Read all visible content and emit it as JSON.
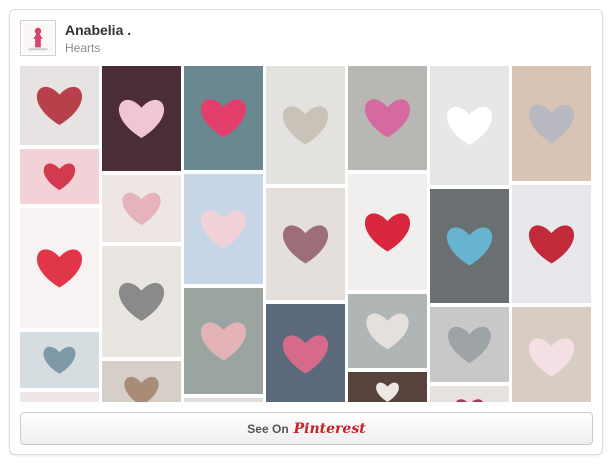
{
  "board": {
    "owner": "Anabelia .",
    "name": "Hearts"
  },
  "avatar_icon": "avatar-icon",
  "pins": [
    {
      "col": 0,
      "desc": "gingham fabric hearts",
      "colors": [
        "#e8e3e3",
        "#b8404a"
      ]
    },
    {
      "col": 0,
      "desc": "crochet heart red",
      "colors": [
        "#f2d2d6",
        "#d23a4f"
      ]
    },
    {
      "col": 0,
      "desc": "heart garland",
      "colors": [
        "#f8f2f2",
        "#e03648"
      ]
    },
    {
      "col": 0,
      "desc": "blue hearts in bowl",
      "colors": [
        "#d6dde0",
        "#7e9aa8"
      ]
    },
    {
      "col": 0,
      "desc": "pink hearts",
      "colors": [
        "#efe7e7",
        "#c8a0a6"
      ]
    },
    {
      "col": 1,
      "desc": "heart bouquet pot",
      "colors": [
        "#4b2d3a",
        "#f0c6d2"
      ]
    },
    {
      "col": 1,
      "desc": "pink felt heart",
      "colors": [
        "#ede6e4",
        "#e7b3bb"
      ]
    },
    {
      "col": 1,
      "desc": "grey fabric hearts",
      "colors": [
        "#e9e6e2",
        "#8a8a8a"
      ]
    },
    {
      "col": 1,
      "desc": "hanging hearts",
      "colors": [
        "#d6cfc8",
        "#a88c78"
      ]
    },
    {
      "col": 2,
      "desc": "pink crochet heart",
      "colors": [
        "#6a8890",
        "#e2406a"
      ]
    },
    {
      "col": 2,
      "desc": "birdhouse hearts",
      "colors": [
        "#c7d6e6",
        "#f0d2d8"
      ]
    },
    {
      "col": 2,
      "desc": "floral fabric heart",
      "colors": [
        "#9aa5a0",
        "#e3b3b8"
      ]
    },
    {
      "col": 2,
      "desc": "red heart",
      "colors": [
        "#e1dedc",
        "#c83a4a"
      ]
    },
    {
      "col": 3,
      "desc": "wicker heart with roses",
      "colors": [
        "#e3e2de",
        "#c8c2b8"
      ]
    },
    {
      "col": 3,
      "desc": "button hearts",
      "colors": [
        "#e5dfdc",
        "#9c6e7a"
      ]
    },
    {
      "col": 3,
      "desc": "knitted striped hearts",
      "colors": [
        "#5a6a7a",
        "#d66a8a"
      ]
    },
    {
      "col": 4,
      "desc": "butterfly heart",
      "colors": [
        "#b9b7b3",
        "#d46aa0"
      ]
    },
    {
      "col": 4,
      "desc": "crochet hearts basket",
      "colors": [
        "#f1eeee",
        "#d7263d"
      ]
    },
    {
      "col": 4,
      "desc": "lace hearts",
      "colors": [
        "#b0b5b6",
        "#e4e1dd"
      ]
    },
    {
      "col": 4,
      "desc": "clay hearts",
      "colors": [
        "#58423c",
        "#ece8e2"
      ]
    },
    {
      "col": 5,
      "desc": "heart in cage",
      "colors": [
        "#e6e8e8",
        "#ffffff"
      ]
    },
    {
      "col": 5,
      "desc": "blue crochet heart",
      "colors": [
        "#6a6f72",
        "#66b4d0"
      ]
    },
    {
      "col": 5,
      "desc": "silver hearts",
      "colors": [
        "#c8c8c8",
        "#9ea3a6"
      ]
    },
    {
      "col": 5,
      "desc": "heart wreath",
      "colors": [
        "#e7e2df",
        "#a33a56"
      ]
    },
    {
      "col": 6,
      "desc": "lace crochet heart",
      "colors": [
        "#d8c4b4",
        "#b8b8c0"
      ]
    },
    {
      "col": 6,
      "desc": "paper hearts",
      "colors": [
        "#e8e8ec",
        "#c22a3a"
      ]
    },
    {
      "col": 6,
      "desc": "heart bowls",
      "colors": [
        "#d8cdc5",
        "#f3dfe4"
      ]
    }
  ],
  "see_on": {
    "label": "See On",
    "brand": "Pinterest"
  }
}
